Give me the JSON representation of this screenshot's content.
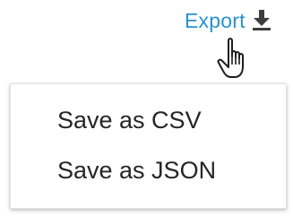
{
  "export": {
    "label": "Export",
    "icon": "download-icon",
    "color": "#2a92d1"
  },
  "cursor": {
    "icon": "hand-pointer-cursor-icon"
  },
  "menu": {
    "items": [
      {
        "label": "Save as CSV"
      },
      {
        "label": "Save as JSON"
      }
    ]
  }
}
